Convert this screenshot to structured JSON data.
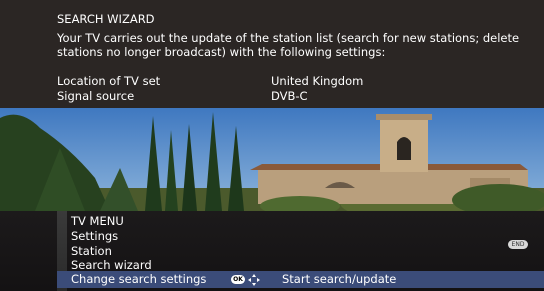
{
  "wizard": {
    "title": "SEARCH WIZARD",
    "description": "Your TV carries out the update of the station list (search for new stations; delete stations no longer broadcast) with the following settings:",
    "settings": [
      {
        "label": "Location of TV set",
        "value": "United Kingdom"
      },
      {
        "label": "Signal source",
        "value": "DVB-C"
      }
    ]
  },
  "menu": {
    "breadcrumb": [
      "TV MENU",
      "Settings",
      "Station",
      "Search wizard"
    ],
    "selected_item": "Change search settings",
    "ok_key": "OK",
    "action_label": "Start search/update",
    "end_key": "END"
  },
  "colors": {
    "panel": "#2b2624",
    "selection": "#3b4c79",
    "text": "#ffffff"
  },
  "icons": [
    "ok-key-icon",
    "navigation-arrows-icon",
    "end-key-icon"
  ]
}
